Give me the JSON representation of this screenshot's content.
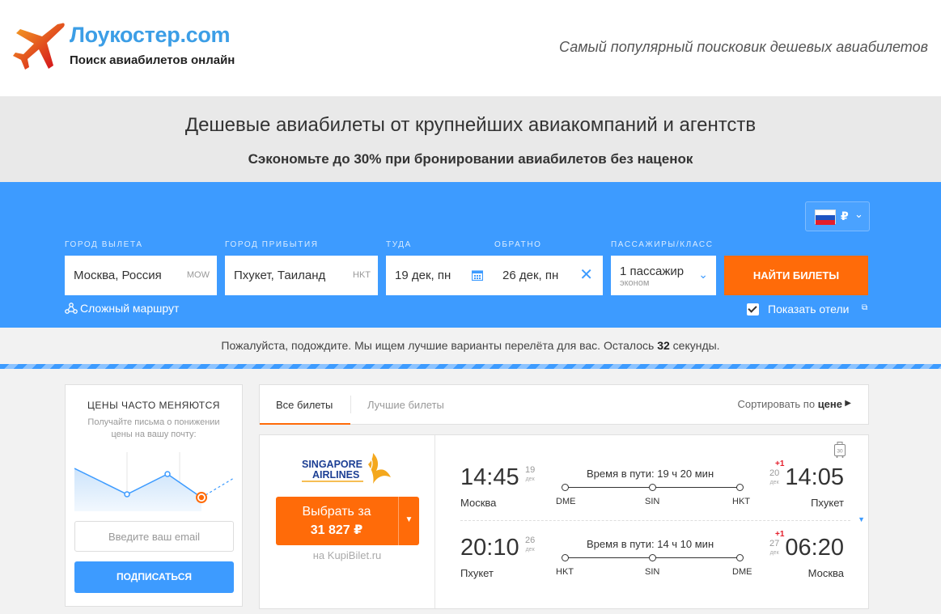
{
  "header": {
    "logo_title": "Лоукостер.com",
    "logo_subtitle": "Поиск авиабилетов онлайн",
    "tagline": "Самый популярный поисковик дешевых авиабилетов"
  },
  "hero": {
    "title": "Дешевые авиабилеты от крупнейших авиакомпаний и агентств",
    "subtitle": "Сэкономьте до 30% при бронировании авиабилетов без наценок"
  },
  "search": {
    "currency_symbol": "₽",
    "origin": {
      "label": "Город вылета",
      "value": "Москва,  Россия",
      "code": "MOW"
    },
    "destination": {
      "label": "Город прибытия",
      "value": "Пхукет,  Таиланд",
      "code": "HKT"
    },
    "depart": {
      "label": "Туда",
      "value": "19 дек, пн"
    },
    "return": {
      "label": "Обратно",
      "value": "26 дек, пн"
    },
    "passengers": {
      "label": "Пассажиры/класс",
      "value": "1 пассажир",
      "class": "эконом"
    },
    "submit_label": "НАЙТИ БИЛЕТЫ",
    "complex_route_label": "Сложный маршрут",
    "show_hotels_label": "Показать отели",
    "show_hotels_checked": true
  },
  "waiting": {
    "text_before": "Пожалуйста, подождите. Мы ищем лучшие варианты перелёта для вас. Осталось ",
    "seconds": "32",
    "text_after": " секунды."
  },
  "subscribe": {
    "title": "ЦЕНЫ ЧАСТО МЕНЯЮТСЯ",
    "description": "Получайте письма о понижении цены на вашу почту:",
    "email_placeholder": "Введите ваш email",
    "button_label": "ПОДПИСАТЬСЯ"
  },
  "tabs": {
    "all_label": "Все билеты",
    "best_label": "Лучшие билеты",
    "sort_prefix": "Сортировать по",
    "sort_field": "цене"
  },
  "ticket": {
    "airline": "Singapore Airlines",
    "airline_logo_line1": "SINGAPORE",
    "airline_logo_line2": "AIRLINES",
    "button_line1": "Выбрать за",
    "button_price": "31 827 ₽",
    "agency": "на KupiBilet.ru",
    "bag_weight": "30",
    "legs": [
      {
        "dep_time": "14:45",
        "dep_day": "19",
        "dep_month": "дек",
        "dep_city": "Москва",
        "duration": "Время в пути: 19 ч  20 мин",
        "stops": [
          "DME",
          "SIN",
          "HKT"
        ],
        "plus_days": "+1",
        "arr_day": "20",
        "arr_month": "дек",
        "arr_time": "14:05",
        "arr_city": "Пхукет"
      },
      {
        "dep_time": "20:10",
        "dep_day": "26",
        "dep_month": "дек",
        "dep_city": "Пхукет",
        "duration": "Время в пути: 14 ч  10 мин",
        "stops": [
          "HKT",
          "SIN",
          "DME"
        ],
        "plus_days": "+1",
        "arr_day": "27",
        "arr_month": "дек",
        "arr_time": "06:20",
        "arr_city": "Москва"
      }
    ]
  },
  "colors": {
    "accent_blue": "#3d9bff",
    "accent_orange": "#ff6b09",
    "logo_blue": "#3c9ee6"
  }
}
